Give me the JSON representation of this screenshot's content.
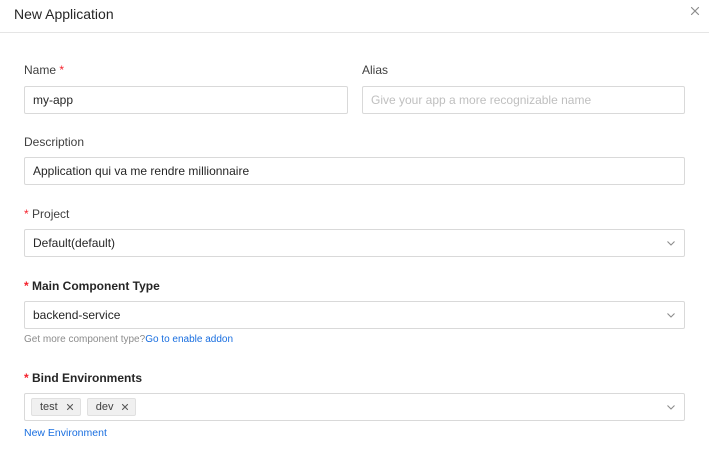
{
  "dialog": {
    "title": "New Application"
  },
  "name": {
    "label": "Name",
    "required_mark": "*",
    "value": "my-app"
  },
  "alias": {
    "label": "Alias",
    "placeholder": "Give your app a more recognizable name"
  },
  "description": {
    "label": "Description",
    "value": "Application qui va me rendre millionnaire"
  },
  "project": {
    "required_mark": "*",
    "label": "Project",
    "selected": "Default(default)"
  },
  "component_type": {
    "required_mark": "*",
    "label": "Main Component Type",
    "selected": "backend-service",
    "hint_prefix": "Get more component type?",
    "hint_link": "Go to enable addon"
  },
  "environments": {
    "required_mark": "*",
    "label": "Bind Environments",
    "tags": [
      "test",
      "dev"
    ],
    "new_link": "New Environment"
  },
  "icons": {
    "close": "close-icon",
    "dropdown": "chevron-down-icon",
    "tag_remove": "tag-close-icon"
  },
  "colors": {
    "required": "#f5222d",
    "link": "#1a6fe0",
    "border": "#d9d9d9",
    "tag_bg": "#f0f0f0"
  }
}
